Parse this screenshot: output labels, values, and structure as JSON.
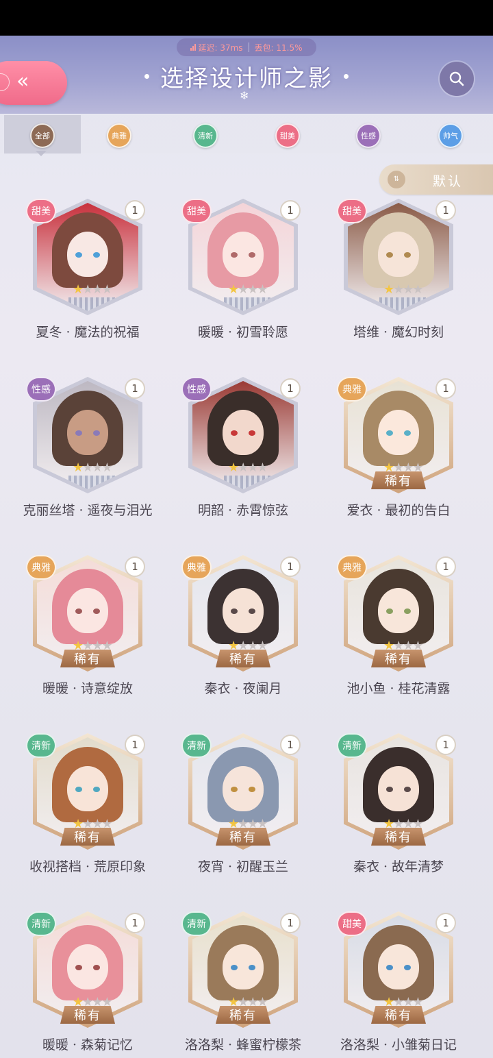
{
  "header": {
    "title": "选择设计师之影",
    "latency_label": "延迟: 37ms",
    "packet_loss_label": "丢包: 11.5%",
    "latency_color": "#ff9a9a"
  },
  "tabs": [
    {
      "label": "全部",
      "color": "#8d6a55",
      "active": true
    },
    {
      "label": "典雅",
      "color": "#e6a55a"
    },
    {
      "label": "清新",
      "color": "#58b78e"
    },
    {
      "label": "甜美",
      "color": "#ec6e86"
    },
    {
      "label": "性感",
      "color": "#9b6fb8"
    },
    {
      "label": "帅气",
      "color": "#5c9ee6"
    }
  ],
  "sort": {
    "label": "默认"
  },
  "cards": [
    {
      "name": "夏冬 · 魔法的祝福",
      "tag": "甜美",
      "count": "1",
      "rare": false
    },
    {
      "name": "暖暖 · 初雪聆愿",
      "tag": "甜美",
      "count": "1",
      "rare": false
    },
    {
      "name": "塔维 · 魔幻时刻",
      "tag": "甜美",
      "count": "1",
      "rare": false
    },
    {
      "name": "克丽丝塔 · 遥夜与泪光",
      "tag": "性感",
      "count": "1",
      "rare": false
    },
    {
      "name": "明韶 · 赤霄惊弦",
      "tag": "性感",
      "count": "1",
      "rare": false
    },
    {
      "name": "爱衣 · 最初的告白",
      "tag": "典雅",
      "count": "1",
      "rare": true
    },
    {
      "name": "暖暖 · 诗意绽放",
      "tag": "典雅",
      "count": "1",
      "rare": true
    },
    {
      "name": "秦衣 · 夜阑月",
      "tag": "典雅",
      "count": "1",
      "rare": true
    },
    {
      "name": "池小鱼 · 桂花清露",
      "tag": "典雅",
      "count": "1",
      "rare": true
    },
    {
      "name": "收视搭档 · 荒原印象",
      "tag": "清新",
      "count": "1",
      "rare": true
    },
    {
      "name": "夜宵 · 初醒玉兰",
      "tag": "清新",
      "count": "1",
      "rare": true
    },
    {
      "name": "秦衣 · 故年清梦",
      "tag": "清新",
      "count": "1",
      "rare": true
    },
    {
      "name": "暖暖 · 森菊记忆",
      "tag": "清新",
      "count": "1",
      "rare": true
    },
    {
      "name": "洛洛梨 · 蜂蜜柠檬茶",
      "tag": "清新",
      "count": "1",
      "rare": true
    },
    {
      "name": "洛洛梨 · 小雏菊日记",
      "tag": "甜美",
      "count": "1",
      "rare": true
    }
  ],
  "rare_label": "稀有",
  "tag_colors": {
    "甜美": "#ec6e86",
    "性感": "#9b6fb8",
    "典雅": "#e6a55a",
    "清新": "#58b78e"
  },
  "art": [
    {
      "hair": "#7d4a3e",
      "skin": "#f8e8e4",
      "eye": "#4fa0d8",
      "bg": "#c8303c"
    },
    {
      "hair": "#e79aa4",
      "skin": "#fbe6e2",
      "eye": "#b06a6a",
      "bg": "#f4d4d8"
    },
    {
      "hair": "#d8c8b0",
      "skin": "#f6e4d8",
      "eye": "#b08a50",
      "bg": "#8a5a46"
    },
    {
      "hair": "#5a4238",
      "skin": "#c89c84",
      "eye": "#8a7ab8",
      "bg": "#bdb8c2"
    },
    {
      "hair": "#3a2e2a",
      "skin": "#f2d8cc",
      "eye": "#c83838",
      "bg": "#9a3a34"
    },
    {
      "hair": "#a88a66",
      "skin": "#fbe8dc",
      "eye": "#5ab0c8",
      "bg": "#e8e2d4"
    },
    {
      "hair": "#e58a98",
      "skin": "#fbe6e2",
      "eye": "#a05a5a",
      "bg": "#f4dcd8"
    },
    {
      "hair": "#3c3232",
      "skin": "#f6e2d6",
      "eye": "#5a4a4a",
      "bg": "#e4e6ee"
    },
    {
      "hair": "#4a3a30",
      "skin": "#f8e6da",
      "eye": "#8aa060",
      "bg": "#e8e4dc"
    },
    {
      "hair": "#b06a40",
      "skin": "#f8e4d8",
      "eye": "#50a8c0",
      "bg": "#e2dccc"
    },
    {
      "hair": "#8a98b0",
      "skin": "#f6e4da",
      "eye": "#c09040",
      "bg": "#e4e6ee"
    },
    {
      "hair": "#3a2e2c",
      "skin": "#f6e2d6",
      "eye": "#5a4a4a",
      "bg": "#e8e4e0"
    },
    {
      "hair": "#e8909a",
      "skin": "#fbe6e2",
      "eye": "#a05050",
      "bg": "#f4dcd8"
    },
    {
      "hair": "#9a7a5a",
      "skin": "#f8e6da",
      "eye": "#4a90c8",
      "bg": "#e8e0cc"
    },
    {
      "hair": "#8a6a50",
      "skin": "#f8e6da",
      "eye": "#4a90c8",
      "bg": "#d8dce6"
    }
  ]
}
